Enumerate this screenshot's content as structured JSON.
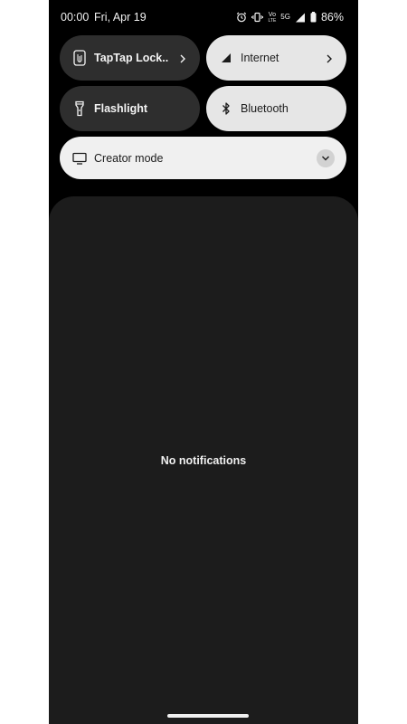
{
  "status_bar": {
    "time": "00:00",
    "date": "Fri, Apr 19",
    "network": "5G",
    "volte_top": "Vo",
    "volte_bottom": "LTE",
    "battery": "86%",
    "icons": [
      "alarm-icon",
      "vibrate-icon",
      "volte-icon",
      "signal-icon",
      "battery-icon"
    ]
  },
  "quick_settings": {
    "tiles": [
      {
        "label": "TapTap Lock..",
        "icon": "taptap-icon",
        "state": "off",
        "has_chevron": true
      },
      {
        "label": "Internet",
        "icon": "signal-icon",
        "state": "on",
        "has_chevron": true
      },
      {
        "label": "Flashlight",
        "icon": "flashlight-icon",
        "state": "off",
        "has_chevron": false
      },
      {
        "label": "Bluetooth",
        "icon": "bluetooth-icon",
        "state": "on",
        "has_chevron": false
      }
    ],
    "creator_mode": {
      "label": "Creator mode",
      "icon": "monitor-icon"
    }
  },
  "notifications": {
    "empty_text": "No notifications"
  },
  "colors": {
    "background": "#000000",
    "tile_dark": "#2e2e2e",
    "tile_light": "#e6e6e6",
    "panel": "#1c1c1c"
  }
}
